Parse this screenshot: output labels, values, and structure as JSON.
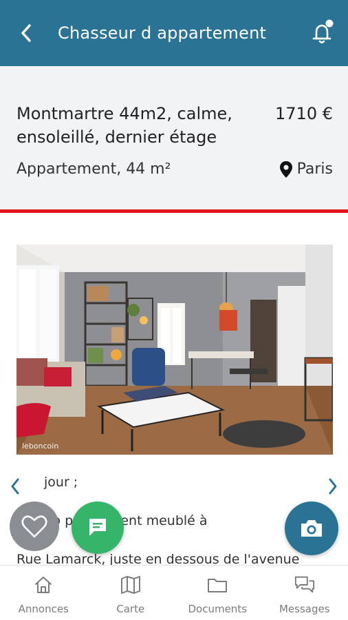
{
  "app_bar": {
    "title": "Chasseur d appartement",
    "back_icon": "chevron-left-icon",
    "notification_icon": "bell-icon",
    "color": "#2b7395"
  },
  "listing": {
    "title": "Montmartre 44m2, calme, ensoleillé, dernier étage",
    "price": "1710 €",
    "subtitle": "Appartement, 44 m²",
    "location": "Paris",
    "accent_color": "#e0141a"
  },
  "gallery": {
    "watermark": "leboncoin",
    "prev_icon": "chevron-left-icon",
    "next_icon": "chevron-right-icon"
  },
  "description": {
    "lines": [
      "jour ;",
      "up     ppartement meublé à",
      "Rue Lamarck, juste en dessous de l'avenue"
    ]
  },
  "fabs": {
    "favorite_icon": "heart-icon",
    "chat_icon": "chat-icon",
    "camera_icon": "camera-icon"
  },
  "bottom_nav": [
    {
      "label": "Annonces",
      "icon": "home-icon"
    },
    {
      "label": "Carte",
      "icon": "map-icon"
    },
    {
      "label": "Documents",
      "icon": "folder-icon"
    },
    {
      "label": "Messages",
      "icon": "messages-icon"
    }
  ]
}
